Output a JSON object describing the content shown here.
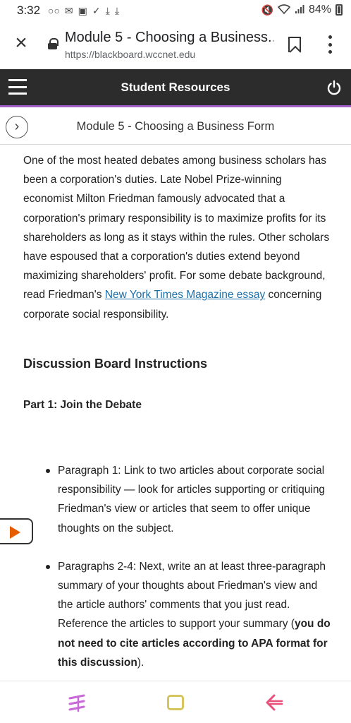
{
  "status_bar": {
    "time": "3:32",
    "battery": "84%",
    "left_icons": [
      "voicemail-icon",
      "gmail-icon",
      "image-icon",
      "check-icon",
      "download-icon",
      "download-icon"
    ],
    "right_icons": [
      "mute-icon",
      "wifi-icon",
      "signal-icon",
      "battery-icon"
    ]
  },
  "browser": {
    "page_title": "Module 5 - Choosing a Business...",
    "url": "https://blackboard.wccnet.edu"
  },
  "app_header": {
    "title": "Student Resources",
    "accent_color": "#a35fc9",
    "bg_color": "#2c2c2c"
  },
  "module_bar": {
    "title": "Module 5 - Choosing a Business Form"
  },
  "content": {
    "intro_part1": "One of the most heated debates among business scholars has been a corporation's duties. Late Nobel Prize-winning economist Milton Friedman famously advocated that a corporation's primary responsibility is to maximize profits for its shareholders as long as it stays within the rules. Other scholars have espoused that a corporation's duties extend beyond maximizing shareholders' profit. For some debate background, read Friedman's ",
    "intro_link": "New York Times Magazine essay",
    "intro_part2": " concerning corporate social responsibility.",
    "link_color": "#1a6fa8",
    "heading_discussion": "Discussion Board Instructions",
    "heading_part1": "Part 1: Join the Debate",
    "bullets": [
      {
        "text": "Paragraph 1: Link to two articles about corporate social responsibility — look for articles supporting or critiquing Friedman's view or articles that seem to offer unique thoughts on the subject."
      },
      {
        "text": "Paragraphs 2-4: Next, write an at least three-paragraph summary of your thoughts about Friedman's view and the article authors' comments that you just read. Reference the articles to support your summary (",
        "bold": "you do not need to cite articles according to APA format for this discussion",
        "tail": ")."
      }
    ]
  }
}
